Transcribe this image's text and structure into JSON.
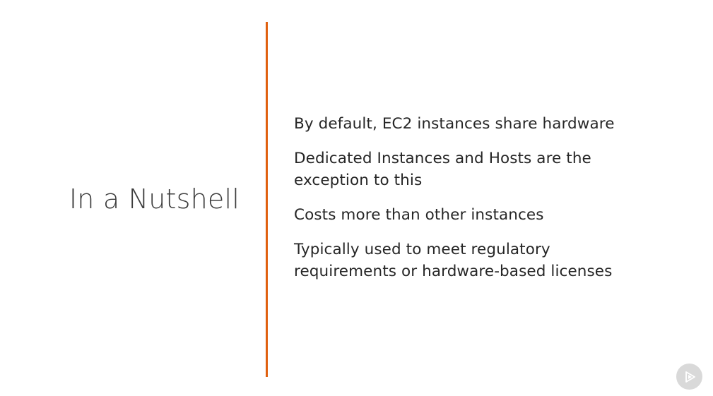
{
  "slide": {
    "title": "In a Nutshell",
    "bullets": [
      {
        "lines": [
          "By default, EC2 instances share hardware"
        ]
      },
      {
        "lines": [
          "Dedicated Instances and Hosts are the",
          "exception to this"
        ]
      },
      {
        "lines": [
          "Costs more than other instances"
        ]
      },
      {
        "lines": [
          "Typically used to meet regulatory",
          "requirements or hardware-based licenses"
        ]
      }
    ]
  },
  "colors": {
    "accent": "#e0600f",
    "title_text": "#3d3d3d",
    "body_text": "#262626",
    "logo_bg": "#d9d9d9"
  },
  "icons": {
    "logo": "play-logo-icon"
  }
}
